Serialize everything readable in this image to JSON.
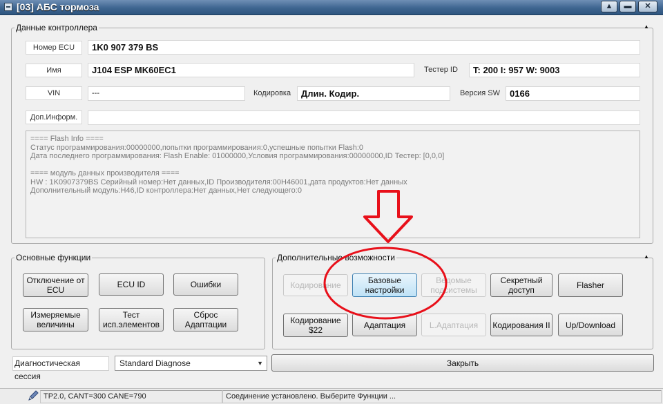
{
  "window": {
    "title": "[03] АБС тормоза",
    "controls": [
      "▲",
      "▬",
      "✕"
    ]
  },
  "controller": {
    "legend": "Данные контроллера",
    "ecu_label": "Номер ECU",
    "ecu_value": "1K0 907 379 BS",
    "name_label": "Имя",
    "name_value": "J104 ESP MK60EC1",
    "tester_label": "Тестер ID",
    "tester_value": "T: 200 I: 957 W: 9003",
    "vin_label": "VIN",
    "vin_value": "---",
    "coding_label": "Кодировка",
    "coding_value": "Длин. Кодир.",
    "sw_label": "Версия SW",
    "sw_value": "0166",
    "extra_label": "Доп.Информ.",
    "extra_value": "",
    "info_lines": [
      "==== Flash Info ====",
      "Статус программирования:00000000,попытки программирования:0,успешные попытки Flash:0",
      "Дата последнего программирования:  Flash Enable: 01000000,Условия программирования:00000000,ID Тестер: [0,0,0]",
      "",
      "==== модуль данных производителя ====",
      "HW : 1K0907379BS Серийный номер:Нет данных,ID Производителя:00H46001,дата продуктов:Нет данных",
      "Дополнительный модуль:H46,ID контроллера:Нет данных,Нет следующего:0"
    ]
  },
  "basic": {
    "legend": "Основные функции",
    "buttons": [
      [
        "Отключение от",
        "ECU"
      ],
      [
        "ECU ID"
      ],
      [
        "Ошибки"
      ],
      [
        "Измеряемые",
        "величины"
      ],
      [
        "Тест",
        "исп.элементов"
      ],
      [
        "Сброс",
        "Адаптации"
      ]
    ]
  },
  "advanced": {
    "legend": "Дополнительные возможности",
    "buttons": [
      [
        "Кодирование"
      ],
      [
        "Базовые",
        "настройки"
      ],
      [
        "Ведомые",
        "подсистемы"
      ],
      [
        "Секретный",
        "доступ"
      ],
      [
        "Flasher"
      ],
      [
        "Кодирование",
        "$22"
      ],
      [
        "Адаптация"
      ],
      [
        "L.Адаптация"
      ],
      [
        "Кодирования II"
      ],
      [
        "Up/Download"
      ]
    ]
  },
  "session": {
    "label": "Диагностическая сессия",
    "value": "Standard Diagnose"
  },
  "close_label": "Закрыть",
  "status": {
    "connection": "TP2.0, CANT=300 CANE=790",
    "message": "Соединение установлено. Выберите Функции ..."
  },
  "colors": {
    "annotation_red": "#e8101a",
    "titlebar": "#3e6590",
    "hot_button": "#bfe2f6"
  }
}
